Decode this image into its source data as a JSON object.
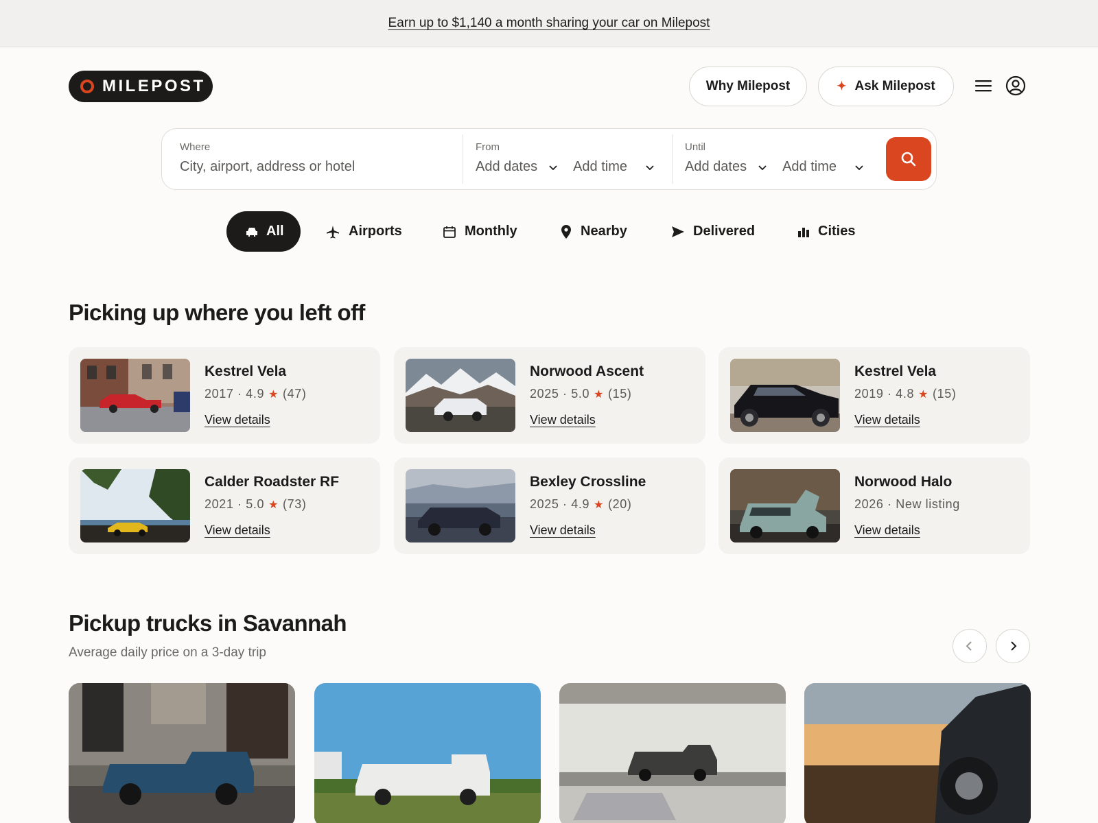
{
  "promo": {
    "text": "Earn up to $1,140 a month sharing your car on Milepost"
  },
  "header": {
    "logo_text": "MILEPOST",
    "why_label": "Why Milepost",
    "ask_label": "Ask Milepost"
  },
  "search": {
    "where_label": "Where",
    "where_placeholder": "City, airport, address or hotel",
    "from_label": "From",
    "from_date": "Add dates",
    "from_time": "Add time",
    "until_label": "Until",
    "until_date": "Add dates",
    "until_time": "Add time"
  },
  "categories": [
    {
      "label": "All",
      "icon": "car-icon",
      "active": true
    },
    {
      "label": "Airports",
      "icon": "airplane-icon"
    },
    {
      "label": "Monthly",
      "icon": "calendar-icon"
    },
    {
      "label": "Nearby",
      "icon": "location-pin-icon"
    },
    {
      "label": "Delivered",
      "icon": "send-arrow-icon"
    },
    {
      "label": "Cities",
      "icon": "city-icon"
    }
  ],
  "recent": {
    "title": "Picking up where you left off",
    "link_label": "View details",
    "items": [
      {
        "name": "Kestrel Vela",
        "year": "2017",
        "rating": "4.9",
        "reviews": "(47)"
      },
      {
        "name": "Norwood Ascent",
        "year": "2025",
        "rating": "5.0",
        "reviews": "(15)"
      },
      {
        "name": "Kestrel Vela",
        "year": "2019",
        "rating": "4.8",
        "reviews": "(15)"
      },
      {
        "name": "Calder Roadster RF",
        "year": "2021",
        "rating": "5.0",
        "reviews": "(73)"
      },
      {
        "name": "Bexley Crossline",
        "year": "2025",
        "rating": "4.9",
        "reviews": "(20)"
      },
      {
        "name": "Norwood Halo",
        "year": "2026",
        "badge": "New listing"
      }
    ]
  },
  "trucks": {
    "title": "Pickup trucks in Savannah",
    "subtitle": "Average daily price on a 3-day trip"
  },
  "colors": {
    "accent": "#d9461f",
    "dark": "#1c1b1a",
    "card_bg": "#f3f2ef"
  }
}
